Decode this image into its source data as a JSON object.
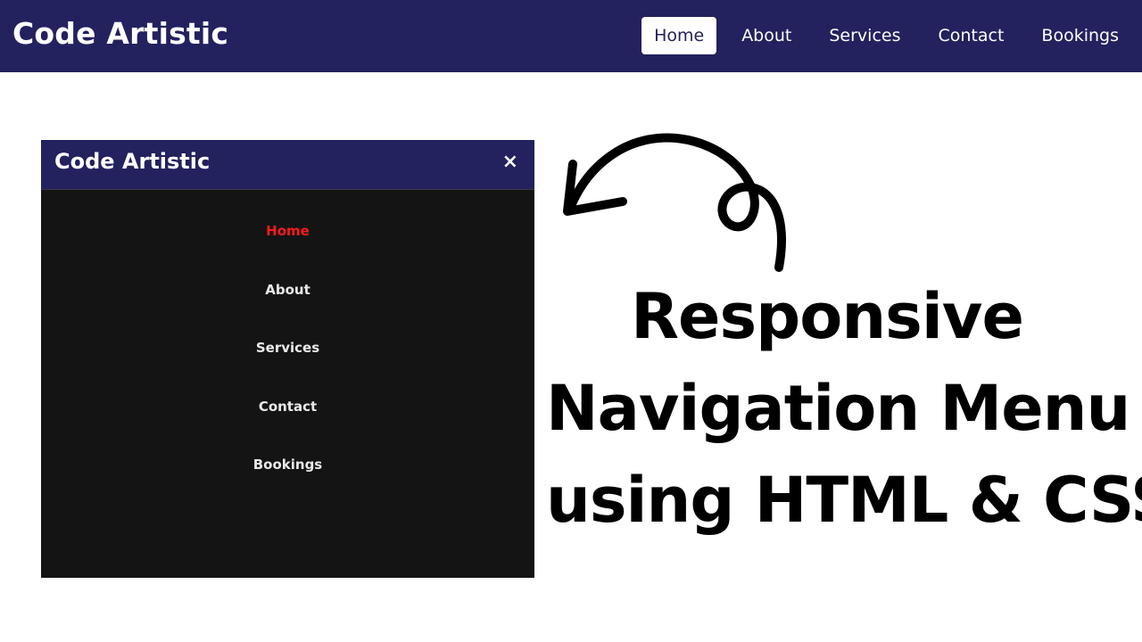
{
  "header": {
    "brand": "Code Artistic",
    "nav": [
      {
        "label": "Home",
        "active": true
      },
      {
        "label": "About",
        "active": false
      },
      {
        "label": "Services",
        "active": false
      },
      {
        "label": "Contact",
        "active": false
      },
      {
        "label": "Bookings",
        "active": false
      }
    ]
  },
  "mobile_menu": {
    "brand": "Code Artistic",
    "close_icon": "×",
    "items": [
      {
        "label": "Home",
        "active": true
      },
      {
        "label": "About",
        "active": false
      },
      {
        "label": "Services",
        "active": false
      },
      {
        "label": "Contact",
        "active": false
      },
      {
        "label": "Bookings",
        "active": false
      }
    ]
  },
  "headline": {
    "line1": "Responsive",
    "line2": "Navigation Menu",
    "line3": "using HTML & CSS"
  },
  "colors": {
    "navbar_bg": "#23215e",
    "mobile_menu_bg": "#141414",
    "mobile_active_link": "#ff1a1a",
    "page_bg": "#ffffff"
  }
}
